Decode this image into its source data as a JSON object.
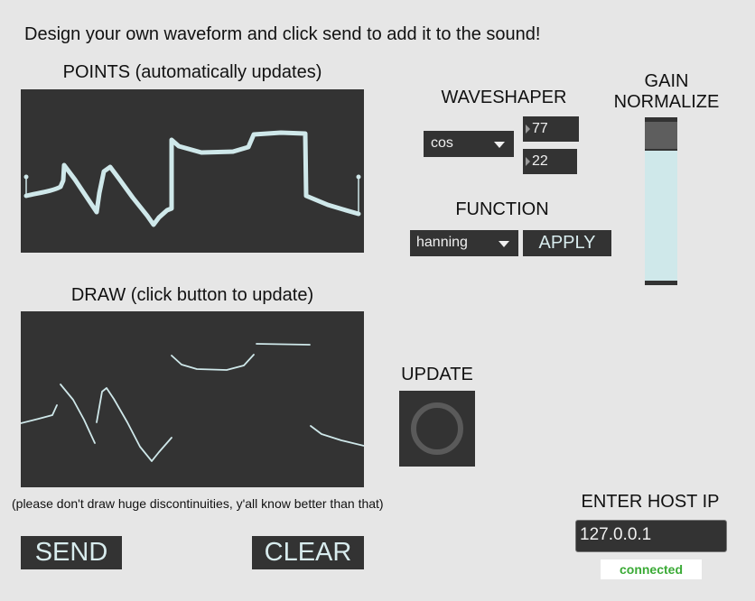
{
  "header": {
    "instruction": "Design your own waveform and click send to add it to the sound!"
  },
  "points": {
    "title": "POINTS (automatically updates)"
  },
  "draw": {
    "title": "DRAW (click button to update)",
    "note": "(please don't draw huge discontinuities, y'all know better than that)"
  },
  "waveshaper": {
    "title": "WAVESHAPER",
    "selected": "cos",
    "value1": "77",
    "value2": "22"
  },
  "function": {
    "title": "FUNCTION",
    "selected": "hanning",
    "apply_label": "APPLY"
  },
  "gain": {
    "title_line1": "GAIN",
    "title_line2": "NORMALIZE",
    "level": 0.83
  },
  "update": {
    "title": "UPDATE"
  },
  "buttons": {
    "send_label": "SEND",
    "clear_label": "CLEAR"
  },
  "host": {
    "title": "ENTER HOST IP",
    "ip": "127.0.0.1",
    "status": "connected"
  },
  "colors": {
    "panel": "#333333",
    "wave": "#cfe8ea",
    "status_green": "#3aaa35",
    "background": "#e6e6e6"
  }
}
